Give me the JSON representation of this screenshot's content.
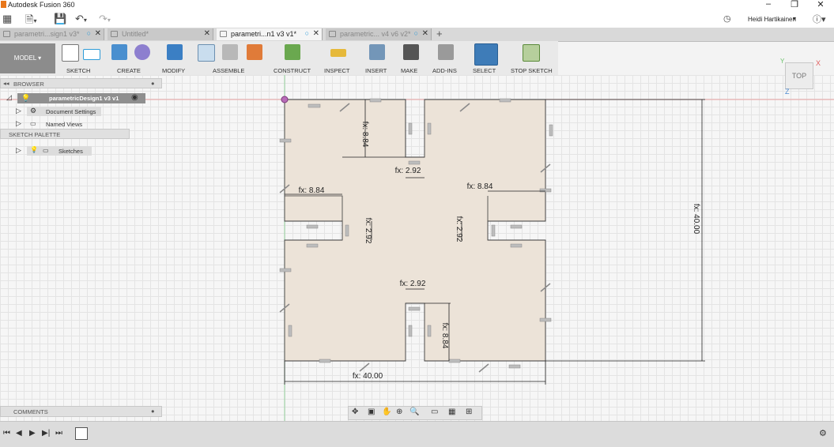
{
  "app": {
    "title": "Autodesk Fusion 360",
    "user": "Heidi Hartikainen"
  },
  "tabs": [
    {
      "label": "parametri...sign1 v3*",
      "active": false
    },
    {
      "label": "Untitled*",
      "active": false
    },
    {
      "label": "parametri...n1 v3 v1*",
      "active": true
    },
    {
      "label": "parametric... v4 v6 v2*",
      "active": false
    }
  ],
  "toolbar": {
    "workspace": "MODEL",
    "groups": [
      "SKETCH",
      "CREATE",
      "MODIFY",
      "ASSEMBLE",
      "CONSTRUCT",
      "INSPECT",
      "INSERT",
      "MAKE",
      "ADD-INS",
      "SELECT",
      "STOP SKETCH"
    ]
  },
  "browser": {
    "header": "BROWSER",
    "root": "parametricDesign1 v3 v1",
    "items": [
      "Document Settings",
      "Named Views",
      "Sketches"
    ],
    "sketch_palette": "SKETCH PALETTE"
  },
  "viewcube": {
    "label": "TOP",
    "axis_x": "X",
    "axis_y": "Y",
    "axis_z": "Z"
  },
  "dimensions": {
    "d_884": "fx: 8.84",
    "d_292": "fx: 2.92",
    "d_40": "fx: 40.00"
  },
  "comments": {
    "header": "COMMENTS"
  },
  "colors": {
    "accent": "#2d9bd8",
    "sketch_fill": "#ece3d8",
    "selection_blue": "#3e7cb8"
  }
}
